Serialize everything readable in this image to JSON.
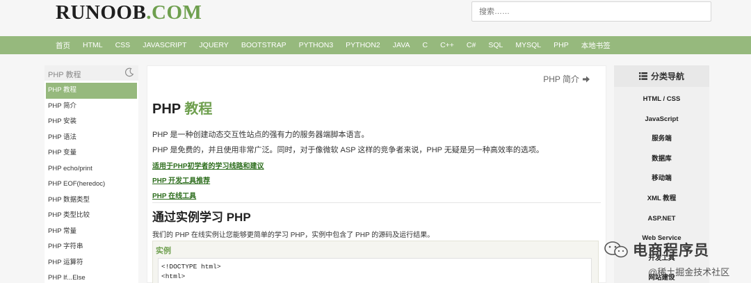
{
  "header": {
    "logo_main": "RUNOOB",
    "logo_com": ".COM",
    "search_placeholder": "搜索……"
  },
  "nav": {
    "items": [
      "首页",
      "HTML",
      "CSS",
      "JAVASCRIPT",
      "JQUERY",
      "BOOTSTRAP",
      "PYTHON3",
      "PYTHON2",
      "JAVA",
      "C",
      "C++",
      "C#",
      "SQL",
      "MYSQL",
      "PHP",
      "本地书签"
    ]
  },
  "sidebar": {
    "title": "PHP 教程",
    "items": [
      "PHP 教程",
      "PHP 简介",
      "PHP 安装",
      "PHP 语法",
      "PHP 变量",
      "PHP echo/print",
      "PHP EOF(heredoc)",
      "PHP 数据类型",
      "PHP 类型比较",
      "PHP 常量",
      "PHP 字符串",
      "PHP 运算符",
      "PHP If...Else"
    ]
  },
  "content": {
    "next_label": "PHP 简介",
    "title_prefix": "PHP",
    "title_accent": "教程",
    "para1": "PHP 是一种创建动态交互性站点的强有力的服务器端脚本语言。",
    "para2": "PHP 是免费的，并且使用非常广泛。同时，对于像微软 ASP 这样的竞争者来说，PHP 无疑是另一种高效率的选项。",
    "link1": "适用于PHP初学者的学习线路和建议",
    "link2": "PHP 开发工具推荐",
    "link3": "PHP 在线工具",
    "section_title": "通过实例学习 PHP",
    "para3": "我们的 PHP 在线实例让您能够更简单的学习 PHP，实例中包含了 PHP 的源码及运行结果。",
    "example_label": "实例",
    "code_line1": "<!DOCTYPE html>",
    "code_line2": "<html>"
  },
  "right_sidebar": {
    "title": "分类导航",
    "items": [
      "HTML / CSS",
      "JavaScript",
      "服务端",
      "数据库",
      "移动端",
      "XML 教程",
      "ASP.NET",
      "Web Service",
      "开发工具",
      "网站建设"
    ]
  },
  "watermark": {
    "line1": "电商程序员",
    "line2": "@稀土掘金技术社区"
  },
  "colors": {
    "accent": "#96b97d",
    "accent_dark": "#6e9f4e"
  }
}
